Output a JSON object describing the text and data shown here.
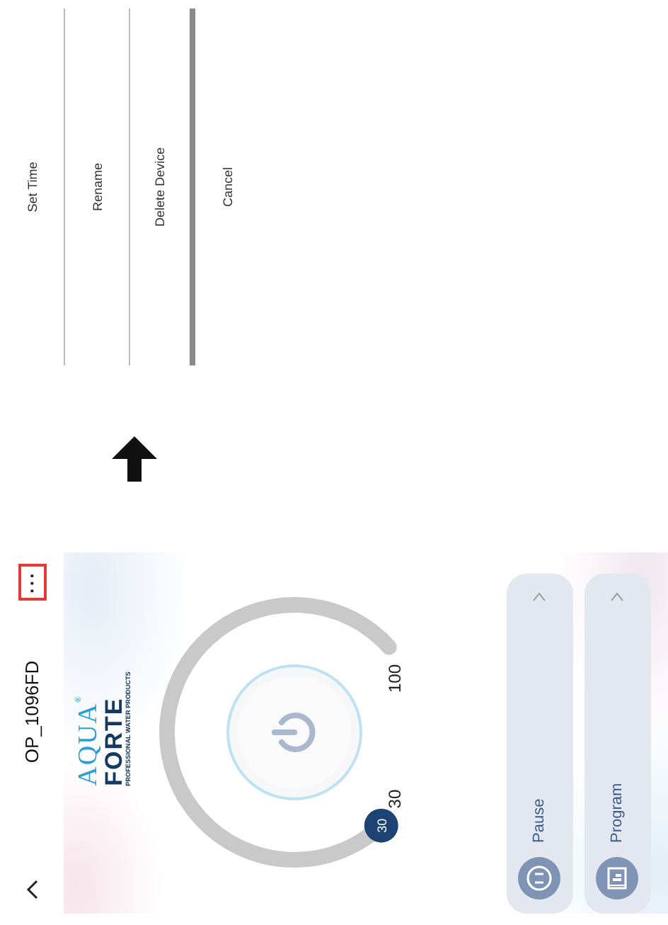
{
  "header": {
    "title": "OP_1096FD",
    "more_button": {
      "label": "···",
      "highlighted": true
    }
  },
  "logo": {
    "word_top": "AQUA",
    "mark": "®",
    "word_bottom": "FORTE",
    "tagline": "PROFESSIONAL WATER PRODUCTS"
  },
  "dial": {
    "thumb_label": "30",
    "min_label": "30",
    "max_label": "100"
  },
  "cards": [
    {
      "label": "Pause",
      "kind": "pause"
    },
    {
      "label": "Program",
      "kind": "program"
    }
  ],
  "action_menu": [
    {
      "label": "Set Time"
    },
    {
      "label": "Rename"
    },
    {
      "label": "Delete Device"
    },
    {
      "label": "Cancel"
    }
  ]
}
